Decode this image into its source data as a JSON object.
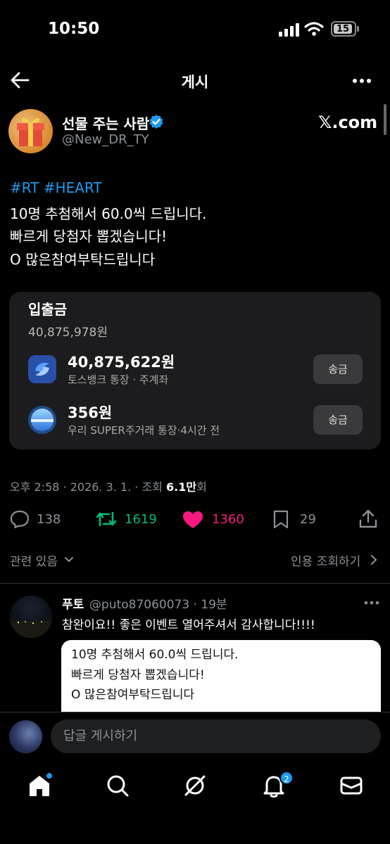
{
  "status_bar": {
    "time": "10:50",
    "battery": "15"
  },
  "header": {
    "title": "게시"
  },
  "author": {
    "display_name": "선물 주는 사람",
    "handle": "@New_DR_TY",
    "brand": "𝕏.com"
  },
  "post": {
    "hashtags": "#RT #HEART",
    "lines": [
      "10명 추첨해서 60.0씩 드립니다.",
      "빠르게 당첨자 뽑겠습니다!",
      "O 많은참여부탁드립니다"
    ]
  },
  "card": {
    "title": "입출금",
    "total": "40,875,978원",
    "accounts": [
      {
        "amount": "40,875,622원",
        "desc": "토스뱅크 통장 · 주계좌",
        "button": "송금"
      },
      {
        "amount": "356원",
        "desc": "우리 SUPER주거래 통장·4시간 전",
        "button": "송금"
      }
    ]
  },
  "meta": {
    "prefix": "오후 2:58 · 2026. 3. 1. · 조회 ",
    "views": "6.1만",
    "suffix": "회"
  },
  "stats": {
    "replies": "138",
    "reposts": "1619",
    "likes": "1360",
    "bookmarks": "29"
  },
  "colors": {
    "repost": "#00ba7c",
    "like": "#f91880",
    "accent": "#1d9bf0"
  },
  "related": {
    "left_label": "관련 있음",
    "right_label": "인용 조회하기"
  },
  "reply": {
    "name": "푸토",
    "handle_time": "@puto87060073 · 19분",
    "text": "참완이요!! 좋은 이벤트 열어주셔서 감사합니다!!!!",
    "image_lines": [
      "10명 추첨해서 60.0씩 드립니다.",
      "빠르게 당첨자 뽑겠습니다!",
      "O 많은참여부탁드립니다"
    ]
  },
  "composer": {
    "placeholder": "답글 게시하기"
  },
  "tabbar": {
    "notifications_badge": "2"
  }
}
